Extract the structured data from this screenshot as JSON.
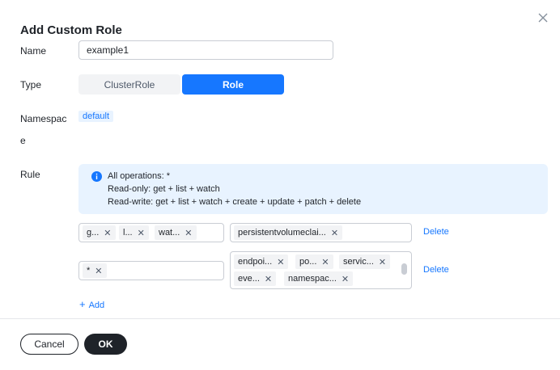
{
  "dialog": {
    "title": "Add Custom Role"
  },
  "form": {
    "name_label": "Name",
    "name_value": "example1",
    "type_label": "Type",
    "type_options": [
      "ClusterRole",
      "Role"
    ],
    "type_selected": "Role",
    "namespace_label_line1": "Namespac",
    "namespace_label_line2": "e",
    "namespace_tag": "default",
    "rule_label": "Rule"
  },
  "info": {
    "lines": [
      "All operations: *",
      "Read-only: get + list + watch",
      "Read-write: get + list + watch + create + update + patch + delete"
    ]
  },
  "rules": [
    {
      "verbs": [
        "g...",
        "l...",
        "wat..."
      ],
      "resources": [
        "persistentvolumeclai..."
      ],
      "delete_label": "Delete"
    },
    {
      "verbs": [
        "*"
      ],
      "resources": [
        "endpoi...",
        "po...",
        "servic...",
        "eve...",
        "namespac..."
      ],
      "delete_label": "Delete"
    }
  ],
  "tag_close_glyph": "✕",
  "add_label": "Add",
  "add_glyph": "+",
  "footer": {
    "cancel_label": "Cancel",
    "ok_label": "OK"
  },
  "colors": {
    "primary": "#1677ff",
    "info_bg": "#e8f3ff",
    "dark_button": "#1f2329"
  },
  "icons": {
    "close": "close-icon",
    "info": "info-icon",
    "tag_remove": "x-icon",
    "add": "plus-icon"
  }
}
